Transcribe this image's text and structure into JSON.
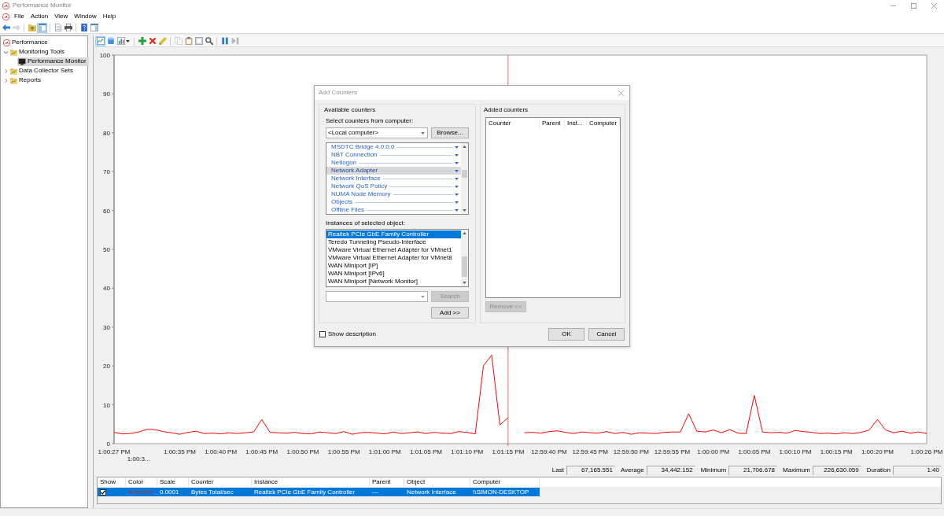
{
  "window": {
    "title": "Performance Monitor"
  },
  "menu": [
    "File",
    "Action",
    "View",
    "Window",
    "Help"
  ],
  "toolbar": [
    {
      "selected": false,
      "disabled": false
    },
    {
      "selected": false,
      "disabled": true
    },
    {
      "selected": false,
      "disabled": false
    },
    {
      "selected": true,
      "disabled": false
    },
    {
      "selected": false,
      "disabled": false
    },
    {
      "selected": false,
      "disabled": false
    },
    {
      "selected": false,
      "disabled": false
    },
    {
      "selected": false,
      "disabled": false
    }
  ],
  "tree": [
    {
      "label": "Performance",
      "selected": false,
      "children": [
        {
          "label": "Monitoring Tools",
          "expanded": true,
          "selected": false,
          "children": [
            {
              "label": "Performance Monitor",
              "selected": true
            }
          ]
        },
        {
          "label": "Data Collector Sets",
          "expanded": false,
          "selected": false
        },
        {
          "label": "Reports",
          "expanded": false,
          "selected": false
        }
      ]
    }
  ],
  "graph_toolbar": [
    {
      "selected": true,
      "disabled": false
    },
    {
      "selected": false,
      "disabled": false
    },
    {
      "selected": false,
      "disabled": false
    },
    {
      "selected": false,
      "disabled": false
    },
    {
      "selected": false,
      "disabled": false
    },
    {
      "selected": false,
      "disabled": false
    },
    {
      "selected": false,
      "disabled": true
    },
    {
      "selected": false,
      "disabled": false
    },
    {
      "selected": false,
      "disabled": false
    },
    {
      "selected": false,
      "disabled": false
    },
    {
      "selected": false,
      "disabled": false
    },
    {
      "selected": false,
      "disabled": true
    }
  ],
  "chart": {
    "chart_data": {
      "type": "line",
      "categories": [
        "1:00:27 PM",
        null,
        null,
        "1:00:3...",
        null,
        null,
        null,
        null,
        "1:00:35 PM",
        null,
        null,
        null,
        null,
        "1:00:40 PM",
        null,
        null,
        null,
        null,
        "1:00:45 PM",
        null,
        null,
        null,
        null,
        "1:00:50 PM",
        null,
        null,
        null,
        null,
        "1:00:55 PM",
        null,
        null,
        null,
        null,
        "1:01:00 PM",
        null,
        null,
        null,
        null,
        "1:01:05 PM",
        null,
        null,
        null,
        null,
        "1:01:10 PM",
        null,
        null,
        null,
        null,
        "1:01:15 PM",
        null,
        null,
        null,
        null,
        "12:59:40 PM",
        null,
        null,
        null,
        null,
        "12:59:45 PM",
        null,
        null,
        null,
        null,
        "12:59:50 PM",
        null,
        null,
        null,
        null,
        "12:59:55 PM",
        null,
        null,
        null,
        null,
        "1:00:00 PM",
        null,
        null,
        null,
        null,
        "1:00:05 PM",
        null,
        null,
        null,
        null,
        "1:00:10 PM",
        null,
        null,
        null,
        null,
        "1:00:15 PM",
        null,
        null,
        null,
        null,
        "1:00:20 PM",
        null,
        null,
        null,
        null,
        null,
        "1:00:26 PM"
      ],
      "series": [
        {
          "color": "#ff0000",
          "values": [
            2.9,
            2.5,
            2.6,
            3.0,
            3.7,
            3.6,
            3.1,
            2.8,
            2.4,
            2.9,
            3.2,
            2.6,
            2.7,
            2.5,
            2.8,
            2.6,
            2.8,
            3.0,
            6.2,
            2.9,
            2.8,
            2.7,
            2.9,
            2.6,
            2.5,
            3.0,
            2.8,
            2.6,
            3.1,
            2.4,
            2.8,
            2.9,
            2.7,
            2.5,
            3.0,
            2.6,
            2.8,
            3.0,
            2.6,
            2.9,
            2.7,
            2.6,
            3.1,
            2.9,
            2.5,
            20.0,
            22.8,
            4.8,
            6.7,
            null,
            2.8,
            2.9,
            2.7,
            3.1,
            3.3,
            2.9,
            2.6,
            3.0,
            2.8,
            2.7,
            3.1,
            2.6,
            2.9,
            2.4,
            2.8,
            2.7,
            2.6,
            2.9,
            3.0,
            3.0,
            7.7,
            3.2,
            3.0,
            3.5,
            2.8,
            3.6,
            2.7,
            2.6,
            12.4,
            3.0,
            2.8,
            2.9,
            2.7,
            3.4,
            3.1,
            2.9,
            2.6,
            2.7,
            2.5,
            2.8,
            2.6,
            2.9,
            3.5,
            6.2,
            3.5,
            2.8,
            3.2,
            2.7,
            3.0,
            2.6
          ]
        }
      ],
      "ylim": [
        0,
        100
      ],
      "yticks": [
        0,
        10,
        20,
        30,
        40,
        50,
        60,
        70,
        80,
        90,
        100
      ]
    }
  },
  "statistics": [
    {
      "label": "Last",
      "value": "67,165.551"
    },
    {
      "label": "Average",
      "value": "34,442.152"
    },
    {
      "label": "Minimum",
      "value": "21,706.678"
    },
    {
      "label": "Maximum",
      "value": "226,630.059"
    },
    {
      "label": "Duration",
      "value": "1:40"
    }
  ],
  "legend": {
    "columns": [
      "Show",
      "Color",
      "Scale",
      "Counter",
      "Instance",
      "Parent",
      "Object",
      "Computer"
    ],
    "rows": [
      {
        "selected": true,
        "show": true,
        "color": "#ff0000",
        "scale": "0.0001",
        "counter": "Bytes Total/sec",
        "instance": "Realtek PCIe GbE Family Controller",
        "parent": "---",
        "object": "Network Interface",
        "computer": "\\\\SIMON-DESKTOP"
      }
    ]
  },
  "dialog": {
    "title": "Add Counters",
    "available_label": "Available counters",
    "computer_label": "Select counters from computer:",
    "computer": "<Local computer>",
    "browse_button": {
      "label": "Browse...",
      "disabled": false
    },
    "counters": [
      {
        "label": "MSDTC Bridge 4.0.0.0",
        "selected": false,
        "expanded": false
      },
      {
        "label": "NBT Connection",
        "selected": false,
        "expanded": false
      },
      {
        "label": "Netlogon",
        "selected": false,
        "expanded": false
      },
      {
        "label": "Network Adapter",
        "selected": true,
        "expanded": false
      },
      {
        "label": "Network Interface",
        "selected": false,
        "expanded": false
      },
      {
        "label": "Network QoS Policy",
        "selected": false,
        "expanded": false
      },
      {
        "label": "NUMA Node Memory",
        "selected": false,
        "expanded": false
      },
      {
        "label": "Objects",
        "selected": false,
        "expanded": false
      },
      {
        "label": "Offline Files",
        "selected": false,
        "expanded": false
      }
    ],
    "instances_label": "Instances of selected object:",
    "instances": [
      {
        "label": "Realtek PCIe GbE Family Controller",
        "selected": true
      },
      {
        "label": "Teredo Tunneling Pseudo-Interface",
        "selected": false
      },
      {
        "label": "VMware Virtual Ethernet Adapter for VMnet1",
        "selected": false
      },
      {
        "label": "VMware Virtual Ethernet Adapter for VMnet8",
        "selected": false
      },
      {
        "label": "WAN Miniport [IP]",
        "selected": false
      },
      {
        "label": "WAN Miniport [IPv6]",
        "selected": false
      },
      {
        "label": "WAN Miniport [Network Monitor]",
        "selected": false
      }
    ],
    "search_button": {
      "label": "Search",
      "disabled": true
    },
    "add_button": {
      "label": "Add >>",
      "disabled": false
    },
    "show_description": {
      "label": "Show description",
      "checked": false
    },
    "added_label": "Added counters",
    "added_columns": [
      "Counter",
      "Parent",
      "Inst...",
      "Computer"
    ],
    "remove_button": {
      "label": "Remove <<",
      "disabled": true
    },
    "ok_button": {
      "label": "OK",
      "disabled": false
    },
    "cancel_button": {
      "label": "Cancel",
      "disabled": false
    }
  }
}
